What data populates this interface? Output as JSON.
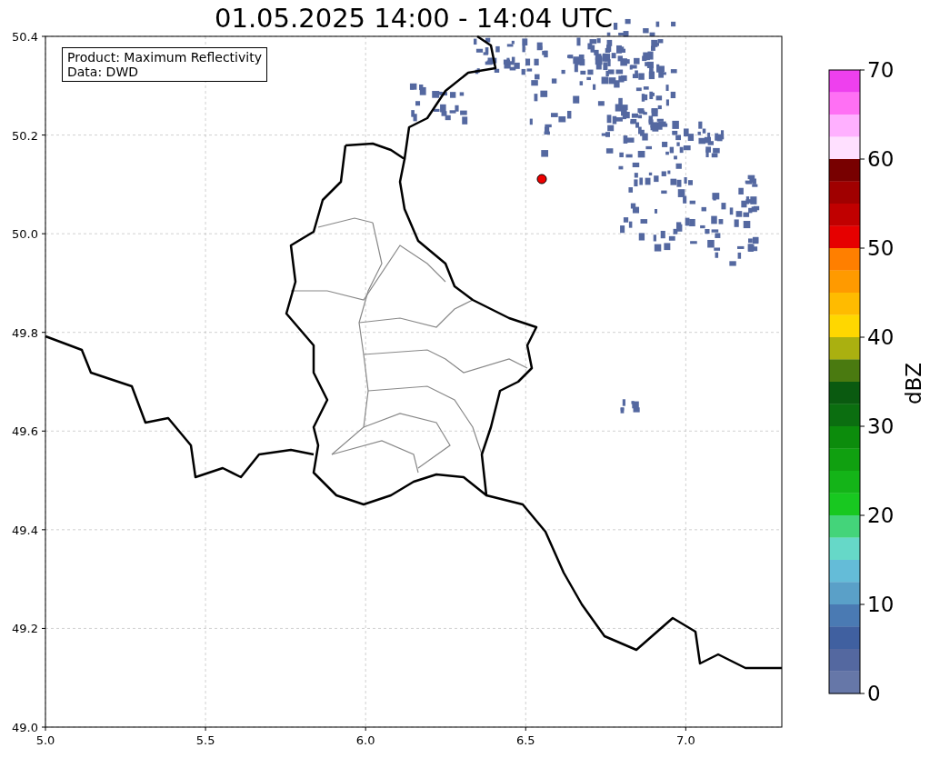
{
  "title": "01.05.2025 14:00 - 14:04 UTC",
  "info_box": [
    "Product: Maximum Reflectivity",
    "Data: DWD"
  ],
  "x_axis": {
    "ticks": [
      "5.0",
      "5.5",
      "6.0",
      "6.5",
      "7.0"
    ]
  },
  "y_axis": {
    "ticks": [
      "50.4",
      "50.2",
      "50.0",
      "49.8",
      "49.6",
      "49.4",
      "49.2",
      "49.0"
    ]
  },
  "colorbar": {
    "label": "dBZ",
    "ticks": [
      "70",
      "60",
      "50",
      "40",
      "30",
      "20",
      "10",
      "0"
    ],
    "bins": [
      {
        "color": "#ee40ee"
      },
      {
        "color": "#ff70f4"
      },
      {
        "color": "#ffb0ff"
      },
      {
        "color": "#ffe0ff"
      },
      {
        "color": "#780000"
      },
      {
        "color": "#a00000"
      },
      {
        "color": "#c00000"
      },
      {
        "color": "#e60000"
      },
      {
        "color": "#ff7f00"
      },
      {
        "color": "#ff9a00"
      },
      {
        "color": "#ffbb00"
      },
      {
        "color": "#ffd700"
      },
      {
        "color": "#aab010"
      },
      {
        "color": "#4a7a10"
      },
      {
        "color": "#0a5a10"
      },
      {
        "color": "#0b6e10"
      },
      {
        "color": "#0c8c0c"
      },
      {
        "color": "#10a010"
      },
      {
        "color": "#14b418"
      },
      {
        "color": "#18c820"
      },
      {
        "color": "#44d47a"
      },
      {
        "color": "#66d8c8"
      },
      {
        "color": "#64bcd8"
      },
      {
        "color": "#5aa0c8"
      },
      {
        "color": "#4a7ab3"
      },
      {
        "color": "#4060a0"
      },
      {
        "color": "#5468a0"
      },
      {
        "color": "#6677a8"
      }
    ]
  }
}
